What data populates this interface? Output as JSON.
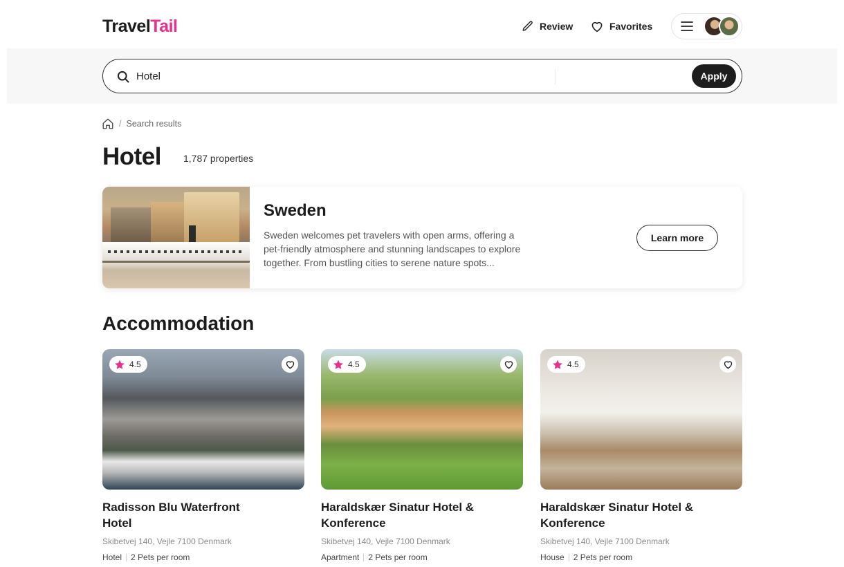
{
  "header": {
    "logo_main": "Travel",
    "logo_accent": "Tail",
    "review_label": "Review",
    "favorites_label": "Favorites"
  },
  "search": {
    "value": "Hotel",
    "apply_label": "Apply"
  },
  "breadcrumb": {
    "separator": "/",
    "current": "Search results"
  },
  "page": {
    "title": "Hotel",
    "count": "1,787 properties"
  },
  "promo": {
    "title": "Sweden",
    "text": "Sweden welcomes pet travelers with open arms, offering a pet-friendly atmosphere and stunning landscapes to explore together. From bustling cities to serene nature spots...",
    "button_label": "Learn more"
  },
  "section": {
    "title": "Accommodation"
  },
  "cards": [
    {
      "rating": "4.5",
      "name": "Radisson Blu Waterfront Hotel",
      "address": "Skibetvej 140, Vejle 7100 Denmark",
      "type": "Hotel",
      "pets": "2 Pets per room"
    },
    {
      "rating": "4.5",
      "name": "Haraldskær Sinatur Hotel & Konference",
      "address": "Skibetvej 140, Vejle 7100 Denmark",
      "type": "Apartment",
      "pets": "2 Pets per room"
    },
    {
      "rating": "4.5",
      "name": "Haraldskær Sinatur Hotel & Konference",
      "address": "Skibetvej 140, Vejle 7100 Denmark",
      "type": "House",
      "pets": "2 Pets per room"
    }
  ],
  "colors": {
    "brand_accent": "#e8318a",
    "primary_dark": "#1e1e1e",
    "star": "#e8318a"
  }
}
